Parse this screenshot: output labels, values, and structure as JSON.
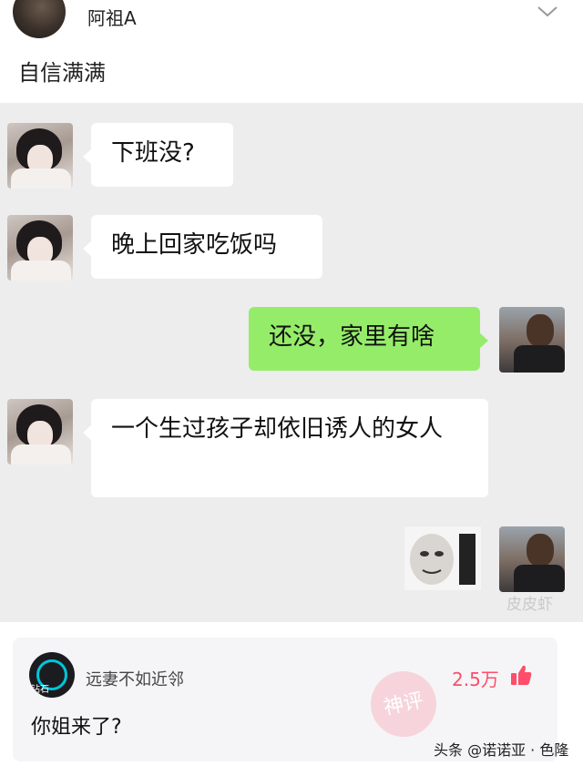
{
  "header": {
    "username": "阿祖A",
    "icon": "chevron-down-icon"
  },
  "post": {
    "title": "自信满满"
  },
  "chat": {
    "messages": [
      {
        "sender": "girl",
        "text": "下班没?"
      },
      {
        "sender": "girl",
        "text": "晚上回家吃饭吗"
      },
      {
        "sender": "man",
        "text": "还没，家里有啥"
      },
      {
        "sender": "girl",
        "text": "一个生过孩子却依旧诱人的女人"
      }
    ],
    "watermark": "皮皮虾",
    "colors": {
      "outgoing": "#95ec69",
      "incoming": "#ffffff",
      "background": "#ededed"
    }
  },
  "comment": {
    "avatar_tag": "钻石",
    "author": "远妻不如近邻",
    "likes": "2.5万",
    "text": "你姐来了?",
    "stamp_text": "神评",
    "like_color": "#ff4d6a"
  },
  "footer": {
    "credit": "头条 @诺诺亚 · 色隆"
  }
}
